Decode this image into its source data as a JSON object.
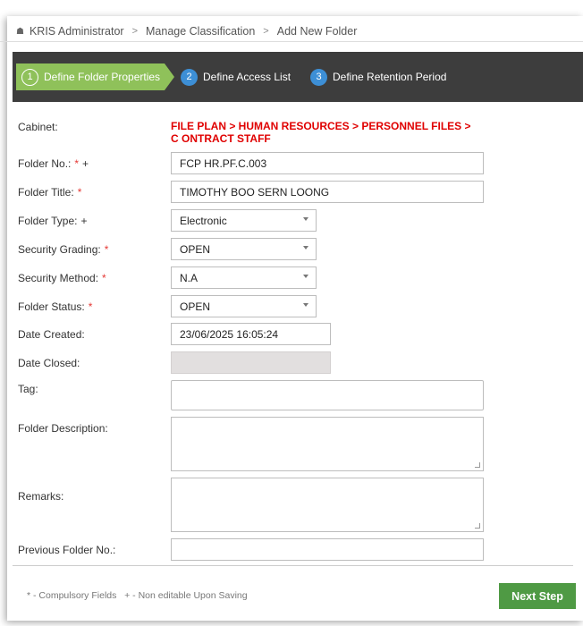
{
  "breadcrumb": {
    "home_icon": "home-icon",
    "items": [
      "KRIS Administrator",
      "Manage Classification",
      "Add New Folder"
    ],
    "separator": ">"
  },
  "wizard": {
    "steps": [
      {
        "num": "1",
        "label": "Define Folder Properties",
        "active": true
      },
      {
        "num": "2",
        "label": "Define Access List",
        "active": false
      },
      {
        "num": "3",
        "label": "Define Retention Period",
        "active": false
      }
    ]
  },
  "form": {
    "cabinet": {
      "label": "Cabinet:",
      "value": "FILE PLAN > HUMAN RESOURCES > PERSONNEL FILES > C ONTRACT STAFF"
    },
    "folder_no": {
      "label": "Folder No.:",
      "required": "*",
      "non_editable": "+",
      "value": "FCP HR.PF.C.003"
    },
    "folder_title": {
      "label": "Folder Title:",
      "required": "*",
      "value": "TIMOTHY BOO SERN LOONG"
    },
    "folder_type": {
      "label": "Folder Type:",
      "non_editable": "+",
      "value": "Electronic"
    },
    "security_grading": {
      "label": "Security Grading:",
      "required": "*",
      "value": "OPEN"
    },
    "security_method": {
      "label": "Security Method:",
      "required": "*",
      "value": "N.A"
    },
    "folder_status": {
      "label": "Folder Status:",
      "required": "*",
      "value": "OPEN"
    },
    "date_created": {
      "label": "Date Created:",
      "value": "23/06/2025 16:05:24"
    },
    "date_closed": {
      "label": "Date Closed:",
      "value": ""
    },
    "tag": {
      "label": "Tag:",
      "value": ""
    },
    "folder_description": {
      "label": "Folder Description:",
      "value": ""
    },
    "remarks": {
      "label": "Remarks:",
      "value": ""
    },
    "previous_folder_no": {
      "label": "Previous Folder No.:",
      "value": ""
    }
  },
  "footer": {
    "legend": "* - Compulsory Fields   + - Non editable Upon Saving",
    "next_label": "Next Step"
  },
  "colors": {
    "wizard_bg": "#3d3d3d",
    "active_step": "#8fc15a",
    "step_badge": "#3d8fd6",
    "required": "#e53935",
    "cabinet_path": "#e00000",
    "next_button": "#4f9a44"
  }
}
